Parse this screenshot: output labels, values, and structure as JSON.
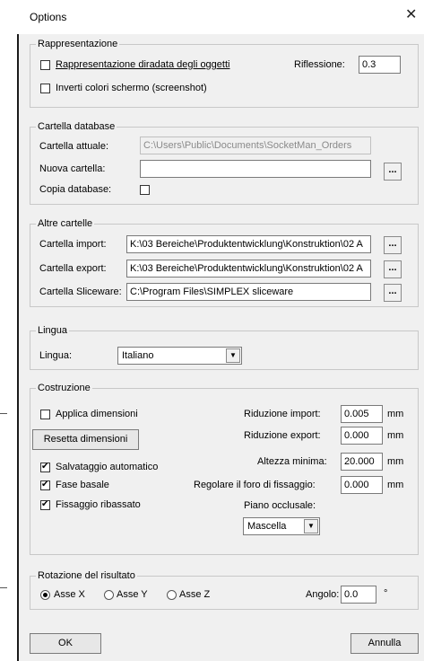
{
  "window": {
    "title": "Options",
    "close_icon": "close-icon"
  },
  "rappresentazione": {
    "legend": "Rappresentazione",
    "option_diradata": {
      "label": "Rappresentazione diradata degli oggetti",
      "checked": false
    },
    "option_inverti": {
      "label": "Inverti colori schermo (screenshot)",
      "checked": false
    },
    "riflessione_label": "Riflessione:",
    "riflessione_value": "0.3"
  },
  "cartella_database": {
    "legend": "Cartella database",
    "attuale_label": "Cartella attuale:",
    "attuale_value": "C:\\Users\\Public\\Documents\\SocketMan_Orders",
    "nuova_label": "Nuova cartella:",
    "nuova_value": "",
    "browse_label": "...",
    "copia_label": "Copia database:",
    "copia_checked": false
  },
  "altre_cartelle": {
    "legend": "Altre cartelle",
    "import_label": "Cartella import:",
    "import_value": "K:\\03 Bereiche\\Produktentwicklung\\Konstruktion\\02 A",
    "export_label": "Cartella export:",
    "export_value": "K:\\03 Bereiche\\Produktentwicklung\\Konstruktion\\02 A",
    "sliceware_label": "Cartella Sliceware:",
    "sliceware_value": "C:\\Program Files\\SIMPLEX sliceware",
    "browse_label": "..."
  },
  "lingua": {
    "legend": "Lingua",
    "label": "Lingua:",
    "selected": "Italiano"
  },
  "costruzione": {
    "legend": "Costruzione",
    "applica_label": "Applica dimensioni",
    "applica_checked": false,
    "resetta_button": "Resetta dimensioni",
    "salvataggio_label": "Salvataggio automatico",
    "salvataggio_checked": true,
    "fase_label": "Fase basale",
    "fase_checked": true,
    "fissaggio_label": "Fissaggio ribassato",
    "fissaggio_checked": true,
    "riduzione_import_label": "Riduzione import:",
    "riduzione_import_value": "0.005",
    "riduzione_export_label": "Riduzione export:",
    "riduzione_export_value": "0.000",
    "altezza_label": "Altezza minima:",
    "altezza_value": "20.000",
    "foro_label": "Regolare il foro di fissaggio:",
    "foro_value": "0.000",
    "unit": "mm",
    "piano_label": "Piano occlusale:",
    "piano_selected": "Mascella"
  },
  "rotazione": {
    "legend": "Rotazione del risultato",
    "asse_x": "Asse X",
    "asse_y": "Asse Y",
    "asse_z": "Asse Z",
    "selected_axis": "Asse X",
    "angolo_label": "Angolo:",
    "angolo_value": "0.0",
    "angolo_unit": "°"
  },
  "footer": {
    "ok_label": "OK",
    "annulla_label": "Annulla"
  }
}
